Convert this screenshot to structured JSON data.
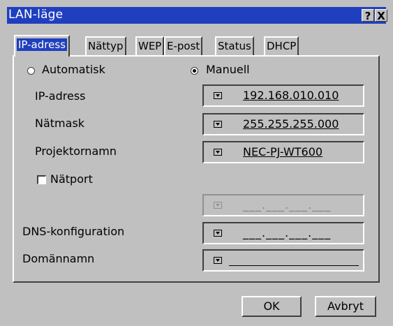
{
  "window": {
    "title": "LAN-läge",
    "help_label": "?",
    "close_label": "X"
  },
  "tabs": [
    {
      "label": "IP-adress",
      "active": true
    },
    {
      "label": "Nättyp"
    },
    {
      "label": "WEP"
    },
    {
      "label": "E-post"
    },
    {
      "label": "Status"
    },
    {
      "label": "DHCP"
    }
  ],
  "mode": {
    "automatic_label": "Automatisk",
    "manual_label": "Manuell",
    "selected": "Manuell"
  },
  "ip_address": {
    "label": "IP-adress",
    "value": "192.168.010.010"
  },
  "netmask": {
    "label": "Nätmask",
    "value": "255.255.255.000"
  },
  "projector_name": {
    "label": "Projektornamn",
    "value": "NEC-PJ-WT600"
  },
  "gateway": {
    "label": "Nätport",
    "checked": false,
    "value": "___.___.___.___"
  },
  "dns": {
    "label": "DNS-konfiguration",
    "value": "___.___.___.___"
  },
  "domain": {
    "label": "Domännamn",
    "value": ""
  },
  "buttons": {
    "ok": "OK",
    "cancel": "Avbryt"
  }
}
